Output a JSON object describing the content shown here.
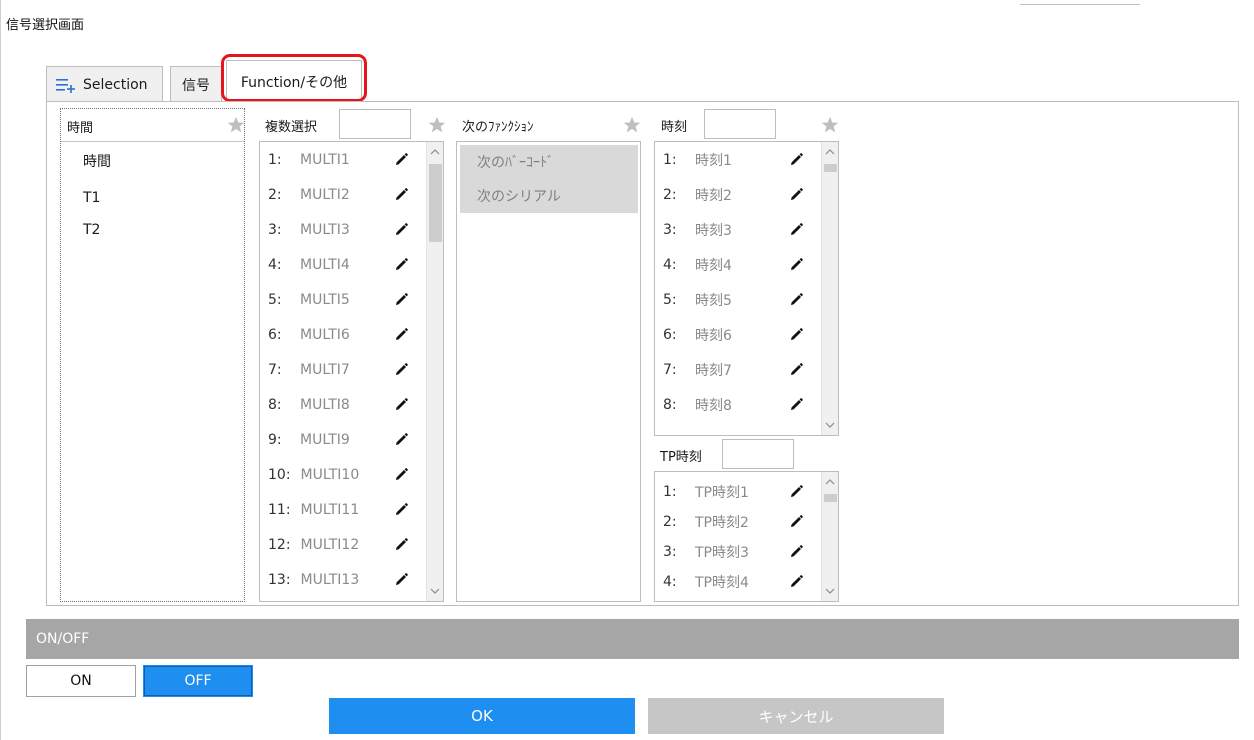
{
  "window": {
    "title": "信号選択画面"
  },
  "tabs": [
    {
      "label": "Selection",
      "icon": "list-plus-icon"
    },
    {
      "label": "信号"
    },
    {
      "label": "Function/その他",
      "active": true
    }
  ],
  "time_column": {
    "header": "時間",
    "items": [
      "時間",
      "T1",
      "T2"
    ]
  },
  "multi_column": {
    "header": "複数選択",
    "rows": [
      {
        "num": "1:",
        "val": "MULTI1"
      },
      {
        "num": "2:",
        "val": "MULTI2"
      },
      {
        "num": "3:",
        "val": "MULTI3"
      },
      {
        "num": "4:",
        "val": "MULTI4"
      },
      {
        "num": "5:",
        "val": "MULTI5"
      },
      {
        "num": "6:",
        "val": "MULTI6"
      },
      {
        "num": "7:",
        "val": "MULTI7"
      },
      {
        "num": "8:",
        "val": "MULTI8"
      },
      {
        "num": "9:",
        "val": "MULTI9"
      },
      {
        "num": "10:",
        "val": "MULTI10"
      },
      {
        "num": "11:",
        "val": "MULTI11"
      },
      {
        "num": "12:",
        "val": "MULTI12"
      },
      {
        "num": "13:",
        "val": "MULTI13"
      }
    ]
  },
  "function_column": {
    "header": "次のﾌｧﾝｸｼｮﾝ",
    "items": [
      "次のﾊﾞｰｺｰﾄﾞ",
      "次のシリアル"
    ]
  },
  "clock_column": {
    "header": "時刻",
    "rows": [
      {
        "num": "1:",
        "val": "時刻1"
      },
      {
        "num": "2:",
        "val": "時刻2"
      },
      {
        "num": "3:",
        "val": "時刻3"
      },
      {
        "num": "4:",
        "val": "時刻4"
      },
      {
        "num": "5:",
        "val": "時刻5"
      },
      {
        "num": "6:",
        "val": "時刻6"
      },
      {
        "num": "7:",
        "val": "時刻7"
      },
      {
        "num": "8:",
        "val": "時刻8"
      }
    ]
  },
  "tp_column": {
    "header": "TP時刻",
    "rows": [
      {
        "num": "1:",
        "val": "TP時刻1"
      },
      {
        "num": "2:",
        "val": "TP時刻2"
      },
      {
        "num": "3:",
        "val": "TP時刻3"
      },
      {
        "num": "4:",
        "val": "TP時刻4"
      }
    ]
  },
  "onoff": {
    "header": "ON/OFF",
    "on_label": "ON",
    "off_label": "OFF",
    "selected": "OFF"
  },
  "actions": {
    "ok_label": "OK",
    "cancel_label": "キャンセル"
  },
  "colors": {
    "accent": "#1e8ef0",
    "highlight": "#e8141b",
    "disabled": "#c6c6c6",
    "section_bar": "#a6a6a6"
  }
}
